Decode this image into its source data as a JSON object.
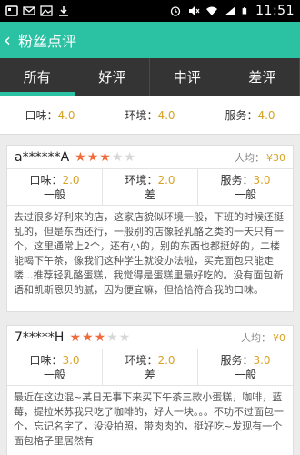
{
  "status": {
    "time": "11:51"
  },
  "header": {
    "title": "粉丝点评"
  },
  "tabs": [
    "所有",
    "好评",
    "中评",
    "差评"
  ],
  "summary": [
    {
      "label": "口味：",
      "value": "4.0"
    },
    {
      "label": "环境：",
      "value": "4.0"
    },
    {
      "label": "服务：",
      "value": "4.0"
    }
  ],
  "reviews": [
    {
      "user": "a******A",
      "stars": 3,
      "avg_label": "人均：",
      "avg_value": "¥30",
      "scores": [
        {
          "label": "口味：",
          "value": "2.0",
          "desc": "一般"
        },
        {
          "label": "环境：",
          "value": "2.0",
          "desc": "差"
        },
        {
          "label": "服务：",
          "value": "3.0",
          "desc": "一般"
        }
      ],
      "text": "去过很多好利来的店，这家店貌似环境一般，下班的时候还挺乱的，但是东西还行，一般别的店像轻乳酪之类的一天只有一个，这里通常上2个，还有小的，别的东西也都挺好的，二楼能喝下午茶，像我们这种学生就没办法啦，买完面包只能走喽...推荐轻乳酪蛋糕，我觉得是蛋糕里最好吃的。没有面包新语和凯斯恩贝的腻，因为便宜嘛，但恰恰符合我的口味。"
    },
    {
      "user": "7*****H",
      "stars": 3,
      "avg_label": "人均：",
      "avg_value": "¥0",
      "scores": [
        {
          "label": "口味：",
          "value": "3.0",
          "desc": "一般"
        },
        {
          "label": "环境：",
          "value": "2.0",
          "desc": "差"
        },
        {
          "label": "服务：",
          "value": "3.0",
          "desc": "一般"
        }
      ],
      "text": "最近在这边混~某日无事下来买下午茶三款小蛋糕，咖啡，蓝莓，提拉米苏我只吃了咖啡的，好大一块。。。不功不过面包一个，忘记名字了，没没拍照，带肉肉的，挺好吃~发现有一个面包格子里居然有"
    }
  ],
  "colors": {
    "accent": "#2bc1a3",
    "value": "#d7a326",
    "star": "#f06a3a",
    "tabbar": "#343434"
  }
}
